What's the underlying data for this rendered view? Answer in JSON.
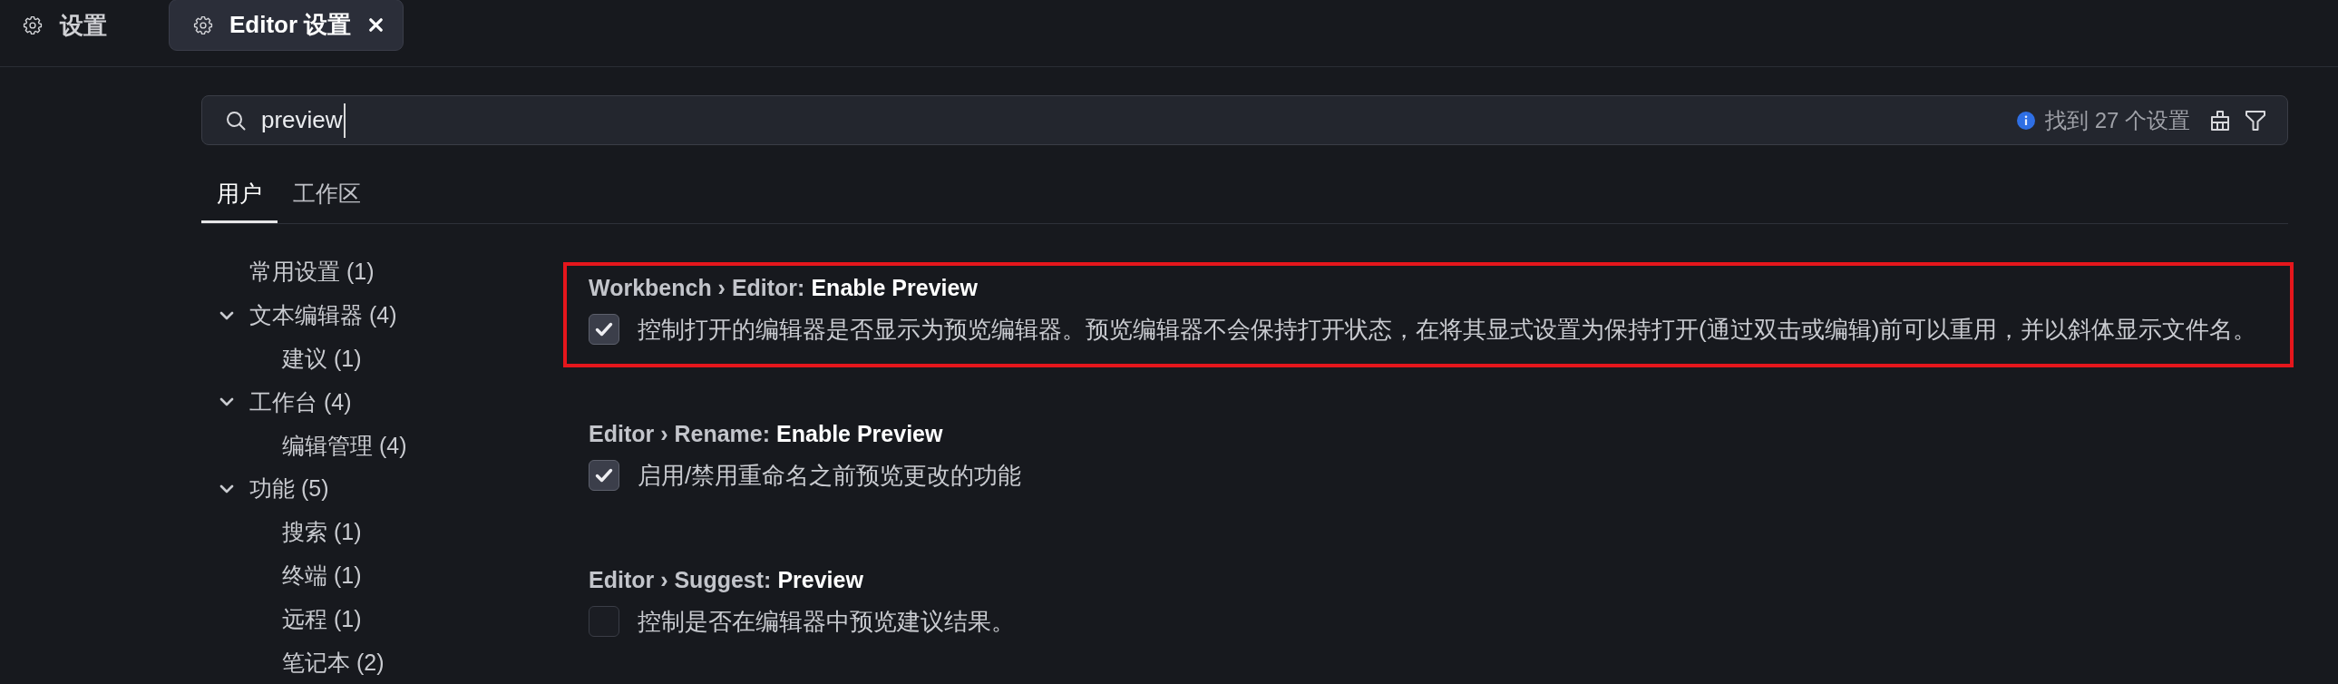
{
  "tabs": [
    {
      "label": "设置",
      "selected": false
    },
    {
      "label": "Editor 设置",
      "selected": true
    }
  ],
  "search": {
    "value": "preview",
    "result_count": "找到 27 个设置"
  },
  "scope_tabs": [
    {
      "label": "用户",
      "selected": true
    },
    {
      "label": "工作区",
      "selected": false
    }
  ],
  "toc": [
    {
      "label": "常用设置 (1)"
    },
    {
      "label": "文本编辑器 (4)",
      "expanded": true,
      "children": [
        {
          "label": "建议 (1)"
        }
      ]
    },
    {
      "label": "工作台 (4)",
      "expanded": true,
      "children": [
        {
          "label": "编辑管理 (4)"
        }
      ]
    },
    {
      "label": "功能 (5)",
      "expanded": true,
      "children": [
        {
          "label": "搜索 (1)"
        },
        {
          "label": "终端 (1)"
        },
        {
          "label": "远程 (1)"
        },
        {
          "label": "笔记本 (2)"
        }
      ]
    }
  ],
  "settings": [
    {
      "category": "Workbench › Editor:",
      "name": "Enable Preview",
      "checked": true,
      "highlighted": true,
      "description": "控制打开的编辑器是否显示为预览编辑器。预览编辑器不会保持打开状态，在将其显式设置为保持打开(通过双击或编辑)前可以重用，并以斜体显示文件名。"
    },
    {
      "category": "Editor › Rename:",
      "name": "Enable Preview",
      "checked": true,
      "highlighted": false,
      "description": "启用/禁用重命名之前预览更改的功能"
    },
    {
      "category": "Editor › Suggest:",
      "name": "Preview",
      "checked": false,
      "highlighted": false,
      "description": "控制是否在编辑器中预览建议结果。"
    }
  ]
}
